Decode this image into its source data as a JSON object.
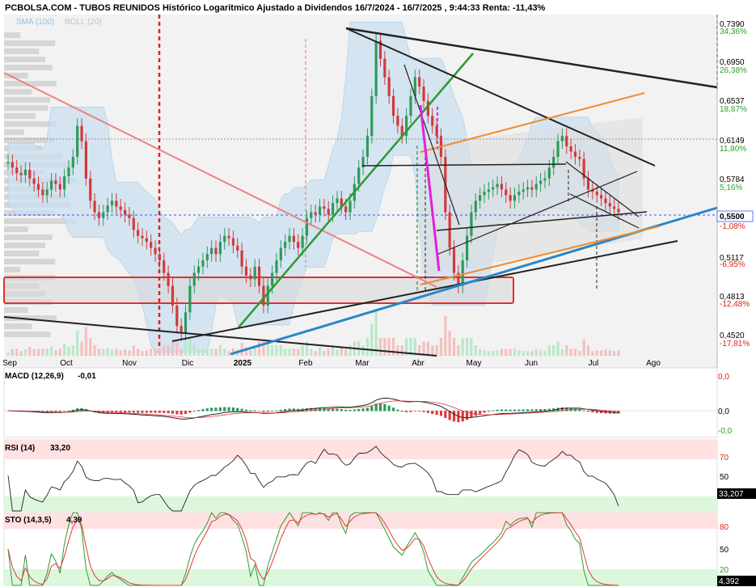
{
  "header": {
    "title": "PCBOLSA.COM - TUBOS REUNIDOS Histórico Logaritmico Ajustado a Dividendos 16/7/2024 - 16/7/2025 , 9:44:33 Renta: -11,43%",
    "legend_sma": "SMA (100)",
    "legend_boll": "BOLL (20)"
  },
  "chart_data": [
    {
      "type": "line",
      "name": "price",
      "title": "PCBOLSA.COM - TUBOS REUNIDOS Histórico Logaritmico Ajustado a Dividendos 16/7/2024 - 16/7/2025 , 9:44:33 Renta: -11,43%",
      "y_scale": "log",
      "x_tick_labels": [
        "Sep",
        "Oct",
        "Nov",
        "Dic",
        "2025",
        "Feb",
        "Mar",
        "Abr",
        "May",
        "Jun",
        "Jul",
        "Ago"
      ],
      "y_ticks": [
        {
          "value": "0,7390",
          "pct": "34,36%",
          "pct_color": "#2ca02c"
        },
        {
          "value": "0,6950",
          "pct": "26,38%",
          "pct_color": "#2ca02c"
        },
        {
          "value": "0,6537",
          "pct": "18,87%",
          "pct_color": "#2ca02c"
        },
        {
          "value": "0,6149",
          "pct": "11,80%",
          "pct_color": "#2ca02c"
        },
        {
          "value": "0,5784",
          "pct": "5,16%",
          "pct_color": "#2ca02c"
        },
        {
          "value": "0,5500",
          "pct": "",
          "pct_color": "#1a1aff"
        },
        {
          "value": "",
          "pct": "-1,08%",
          "pct_color": "#e0201a"
        },
        {
          "value": "0,5117",
          "pct": "-6,95%",
          "pct_color": "#e0201a"
        },
        {
          "value": "0,4813",
          "pct": "-12,48%",
          "pct_color": "#e0201a"
        },
        {
          "value": "0,4520",
          "pct": "-17,81%",
          "pct_color": "#e0201a"
        }
      ],
      "current_value": "0,5500",
      "series_close": [
        0.595,
        0.59,
        0.585,
        0.583,
        0.588,
        0.58,
        0.575,
        0.57,
        0.565,
        0.57,
        0.578,
        0.575,
        0.57,
        0.582,
        0.59,
        0.6,
        0.63,
        0.615,
        0.58,
        0.56,
        0.55,
        0.545,
        0.55,
        0.556,
        0.56,
        0.555,
        0.552,
        0.548,
        0.545,
        0.535,
        0.53,
        0.528,
        0.525,
        0.52,
        0.515,
        0.51,
        0.5,
        0.49,
        0.475,
        0.46,
        0.455,
        0.47,
        0.49,
        0.5,
        0.505,
        0.51,
        0.515,
        0.52,
        0.515,
        0.525,
        0.53,
        0.528,
        0.522,
        0.518,
        0.505,
        0.498,
        0.495,
        0.505,
        0.49,
        0.475,
        0.49,
        0.5,
        0.51,
        0.52,
        0.525,
        0.53,
        0.525,
        0.52,
        0.53,
        0.545,
        0.55,
        0.548,
        0.555,
        0.553,
        0.548,
        0.558,
        0.562,
        0.555,
        0.55,
        0.56,
        0.575,
        0.59,
        0.6,
        0.62,
        0.66,
        0.72,
        0.7,
        0.68,
        0.66,
        0.64,
        0.63,
        0.62,
        0.64,
        0.66,
        0.68,
        0.67,
        0.655,
        0.64,
        0.63,
        0.62,
        0.6,
        0.55,
        0.52,
        0.5,
        0.49,
        0.51,
        0.53,
        0.55,
        0.56,
        0.565,
        0.568,
        0.57,
        0.572,
        0.575,
        0.57,
        0.565,
        0.56,
        0.565,
        0.568,
        0.57,
        0.572,
        0.57,
        0.575,
        0.578,
        0.58,
        0.59,
        0.6,
        0.615,
        0.62,
        0.61,
        0.605,
        0.6,
        0.598,
        0.58,
        0.57,
        0.568,
        0.565,
        0.562,
        0.558,
        0.555,
        0.553,
        0.55
      ]
    },
    {
      "type": "line",
      "name": "MACD",
      "label": "MACD (12,26,9)",
      "last": "-0,01",
      "y_ticks": [
        "0,0",
        "0,0",
        "-0,0"
      ]
    },
    {
      "type": "line",
      "name": "RSI",
      "label": "RSI (14)",
      "last": "33,20",
      "last_box": "33,207",
      "y_ticks": [
        "70",
        "50"
      ],
      "overbought": 70,
      "oversold": 30
    },
    {
      "type": "line",
      "name": "STO",
      "label": "STO (14,3,5)",
      "last": "4,39",
      "last_box": "4,392",
      "y_ticks": [
        "80",
        "50",
        "20"
      ],
      "overbought": 80,
      "oversold": 20
    }
  ]
}
